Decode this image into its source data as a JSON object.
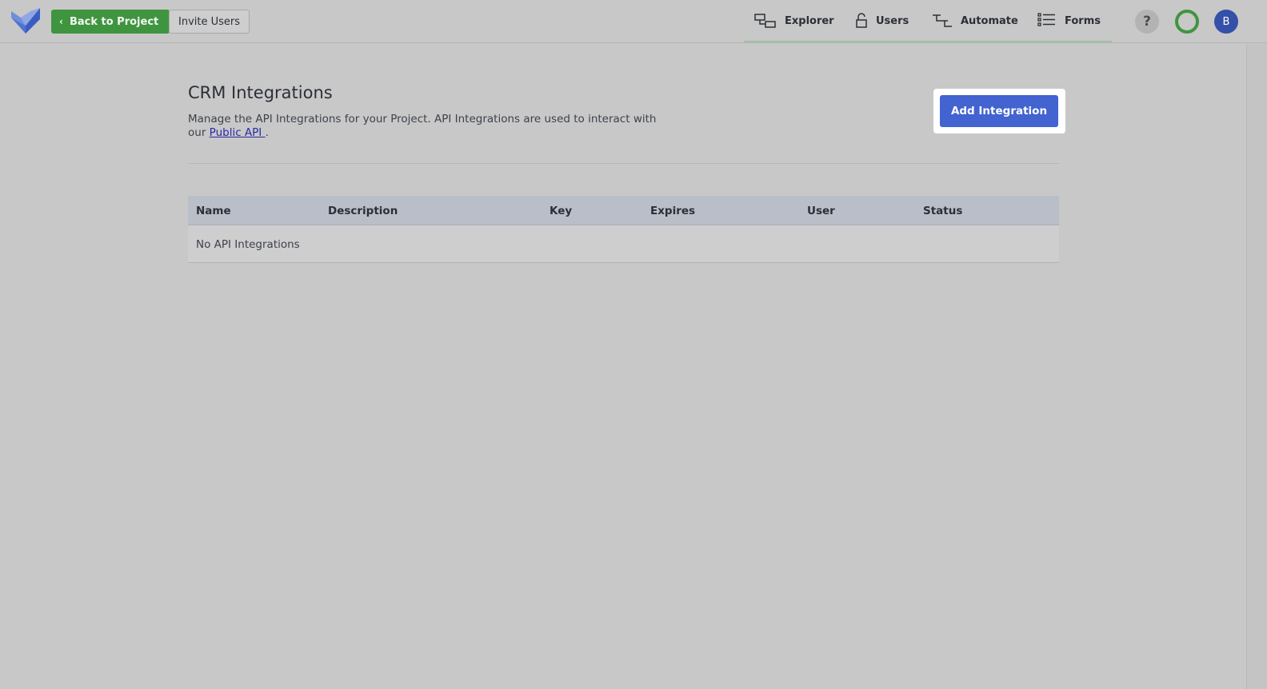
{
  "header": {
    "back_label": "Back to Project",
    "invite_label": "Invite Users",
    "help_label": "?",
    "avatar_initial": "B"
  },
  "nav": {
    "items": [
      {
        "label": "Explorer",
        "icon": "explorer-icon"
      },
      {
        "label": "Users",
        "icon": "lock-icon"
      },
      {
        "label": "Automate",
        "icon": "automate-icon"
      },
      {
        "label": "Forms",
        "icon": "forms-icon"
      }
    ]
  },
  "page": {
    "title": "CRM Integrations",
    "description_line1": "Manage the API Integrations for your Project. API Integrations are used to interact with",
    "description_prefix": "our ",
    "description_link": "Public API ",
    "description_suffix": ".",
    "add_button_label": "Add Integration"
  },
  "table": {
    "columns": [
      "Name",
      "Description",
      "Key",
      "Expires",
      "User",
      "Status"
    ],
    "empty_text": "No API Integrations"
  },
  "colors": {
    "back_button": "#3f953f",
    "add_button": "#4263d0",
    "avatar": "#3450a8",
    "status_ring": "#3f953f"
  }
}
